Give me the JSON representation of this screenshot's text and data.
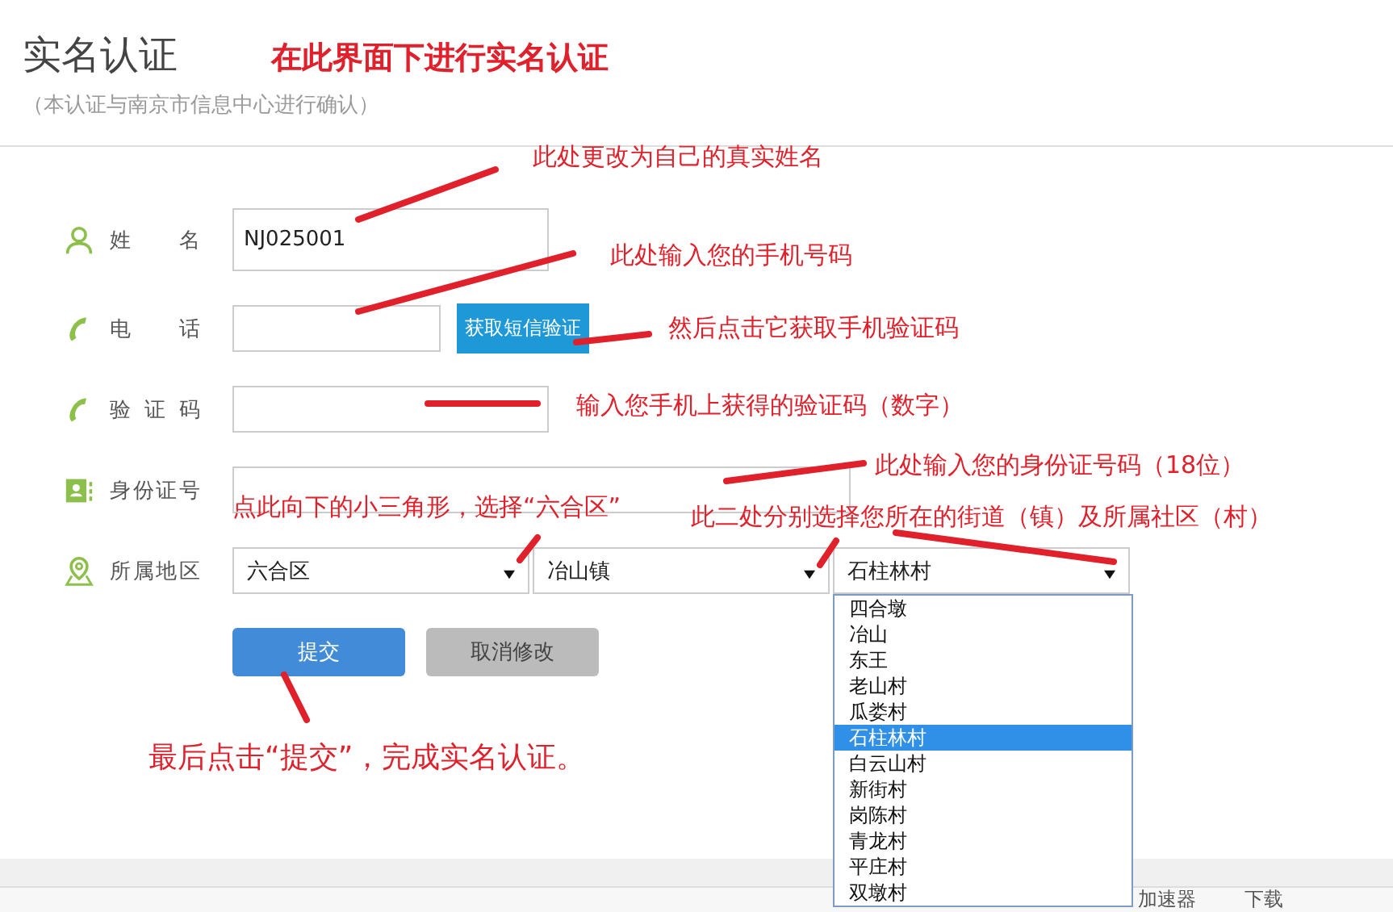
{
  "header": {
    "title": "实名认证",
    "subtitle": "（本认证与南京市信息中心进行确认）",
    "annotation": "在此界面下进行实名认证"
  },
  "form": {
    "rows": [
      {
        "kind": "input",
        "label": "姓 名",
        "value": "NJ025001"
      },
      {
        "kind": "input_button",
        "label": "电 话",
        "value": "",
        "button": "获取短信验证"
      },
      {
        "kind": "input",
        "label": "验 证 码",
        "value": ""
      },
      {
        "kind": "input_wide",
        "label": "身份证号",
        "value": ""
      },
      {
        "kind": "selects",
        "label": "所属地区",
        "selects": [
          {
            "value": "六合区"
          },
          {
            "value": "冶山镇"
          },
          {
            "value": "石柱林村",
            "expanded": true,
            "options": [
              {
                "label": "四合墩",
                "selected": false
              },
              {
                "label": "冶山",
                "selected": false
              },
              {
                "label": "东王",
                "selected": false
              },
              {
                "label": "老山村",
                "selected": false
              },
              {
                "label": "瓜娄村",
                "selected": false
              },
              {
                "label": "石柱林村",
                "selected": true
              },
              {
                "label": "白云山村",
                "selected": false
              },
              {
                "label": "新街村",
                "selected": false
              },
              {
                "label": "岗陈村",
                "selected": false
              },
              {
                "label": "青龙村",
                "selected": false
              },
              {
                "label": "平庄村",
                "selected": false
              },
              {
                "label": "双墩村",
                "selected": false
              }
            ]
          }
        ]
      }
    ],
    "buttons": [
      {
        "kind": "primary",
        "label": "提交"
      },
      {
        "kind": "secondary",
        "label": "取消修改"
      }
    ]
  },
  "annotations": [
    {
      "text": "此处更改为自己的真实姓名"
    },
    {
      "text": "此处输入您的手机号码"
    },
    {
      "text": "然后点击它获取手机验证码"
    },
    {
      "text": "输入您手机上获得的验证码（数字）"
    },
    {
      "text": "此处输入您的身份证号码（18位）"
    },
    {
      "text": "点此向下的小三角形，选择“六合区”"
    },
    {
      "text": "此二处分别选择您所在的街道（镇）及所属社区（村）"
    },
    {
      "text": "最后点击“提交”，完成实名认证。"
    }
  ],
  "browser_bar": {
    "items": [
      "加速器",
      "下载"
    ]
  }
}
